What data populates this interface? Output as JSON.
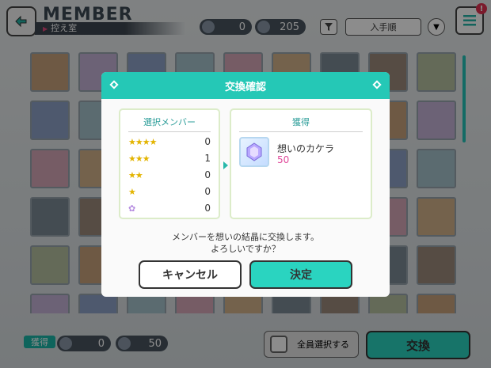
{
  "header": {
    "title": "MEMBER",
    "subtitle": "控え室",
    "item_count_1": "0",
    "item_count_2": "205",
    "sort_label": "入手順",
    "menu_badge": "!"
  },
  "icons": [
    "back-arrow-icon",
    "gem-icon",
    "filter-icon",
    "sort-order-icon",
    "menu-icon",
    "star-icon",
    "crystal-icon"
  ],
  "colors": {
    "accent": "#25c8b6",
    "star": "#e3b400",
    "pink": "#e14a9b"
  },
  "dialog": {
    "title": "交換確認",
    "selected_title": "選択メンバー",
    "rarities": [
      {
        "stars": "★★★★",
        "count": "0"
      },
      {
        "stars": "★★★",
        "count": "1"
      },
      {
        "stars": "★★",
        "count": "0"
      },
      {
        "stars": "★",
        "count": "0"
      },
      {
        "stars": "✿",
        "count": "0"
      }
    ],
    "reward_title": "獲得",
    "reward_name": "想いのカケラ",
    "reward_qty": "50",
    "message_line1": "メンバーを想いの結晶に交換します。",
    "message_line2": "よろしいですか？",
    "cancel_label": "キャンセル",
    "confirm_label": "決定"
  },
  "footer": {
    "gain_label": "獲得",
    "gain_count_1": "0",
    "gain_count_2": "50",
    "select_all_label": "全員選択する",
    "exchange_label": "交換"
  }
}
